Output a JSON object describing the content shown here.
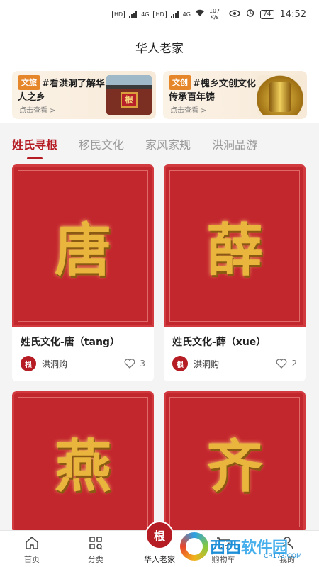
{
  "status_bar": {
    "net_chips": [
      "HD",
      "HD"
    ],
    "net_labels": [
      "4G",
      "4G"
    ],
    "speed_value": "107",
    "speed_unit": "K/s",
    "battery": "74",
    "time": "14:52"
  },
  "title": "华人老家",
  "banners": [
    {
      "tag": "文旅",
      "text": "#看洪洞了解华人之乡",
      "sub": "点击查看 >",
      "thumb_text": "根"
    },
    {
      "tag": "文创",
      "text": "#槐乡文创文化传承百年铸",
      "sub": "点击查看 >"
    }
  ],
  "tabs": [
    {
      "label": "姓氏寻根",
      "active": true
    },
    {
      "label": "移民文化",
      "active": false
    },
    {
      "label": "家风家规",
      "active": false
    },
    {
      "label": "洪洞品游",
      "active": false
    }
  ],
  "cards": [
    {
      "glyph": "唐",
      "title": "姓氏文化-唐（tang）",
      "shop": "洪洞购",
      "avatar": "根",
      "likes": "3"
    },
    {
      "glyph": "薛",
      "title": "姓氏文化-薛（xue）",
      "shop": "洪洞购",
      "avatar": "根",
      "likes": "2"
    },
    {
      "glyph": "燕"
    },
    {
      "glyph": "齐"
    }
  ],
  "bottom_nav": [
    {
      "label": "首页",
      "icon": "home-icon"
    },
    {
      "label": "分类",
      "icon": "category-icon"
    },
    {
      "label": "华人老家",
      "icon": "logo-icon",
      "logo_text": "根"
    },
    {
      "label": "购物车",
      "icon": "cart-icon"
    },
    {
      "label": "我的",
      "icon": "user-icon"
    }
  ],
  "watermark": {
    "text_a": "西西",
    "text_b": "软件园",
    "url": "CR173.COM"
  },
  "colors": {
    "accent": "#b51c24",
    "poster": "#c3272e",
    "gold": "#e9b53d",
    "tag": "#e6862a"
  }
}
